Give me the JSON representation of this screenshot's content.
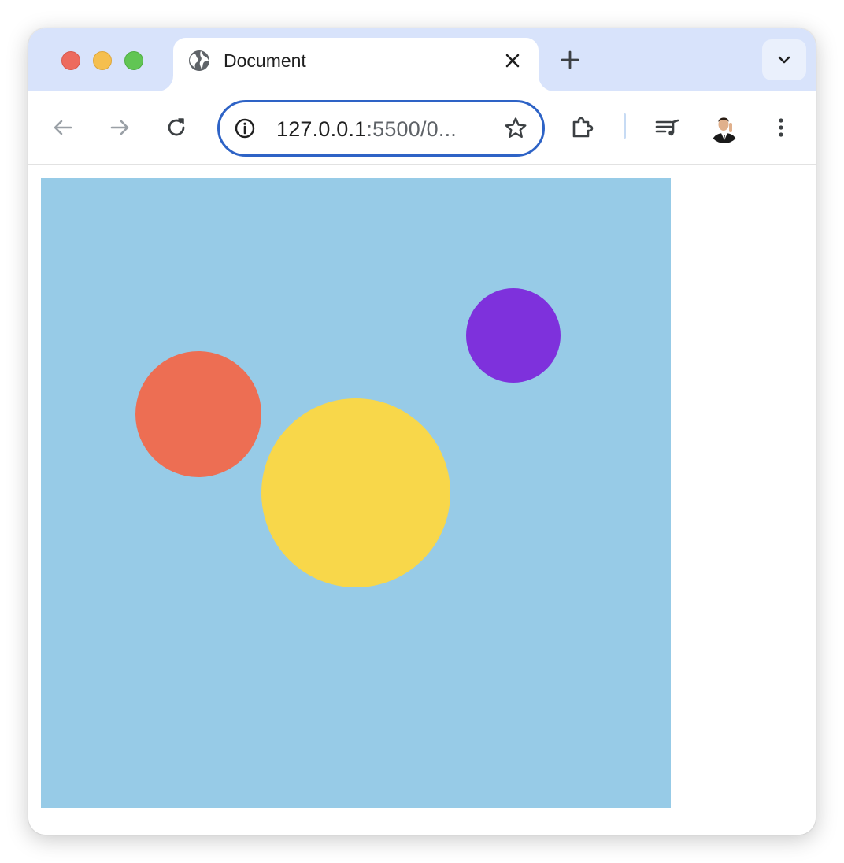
{
  "browser": {
    "tab": {
      "title": "Document",
      "favicon": "globe-icon"
    },
    "address_bar": {
      "host": "127.0.0.1",
      "path_truncated": ":5500/0..."
    }
  },
  "page": {
    "canvas_background": "#97cbe7",
    "circles": [
      {
        "name": "red",
        "color": "#ed6e53"
      },
      {
        "name": "yellow",
        "color": "#f8d74a"
      },
      {
        "name": "purple",
        "color": "#7e31dc"
      }
    ]
  }
}
